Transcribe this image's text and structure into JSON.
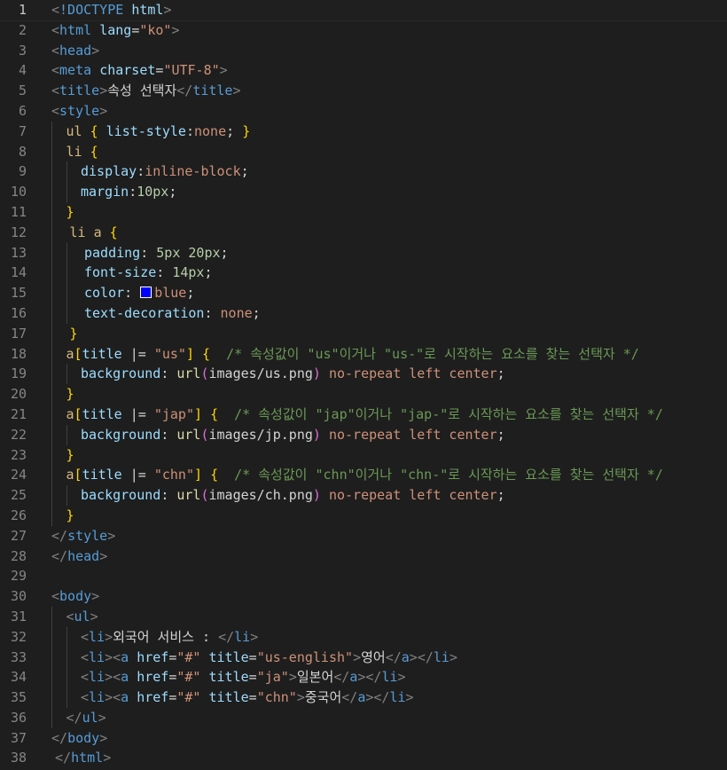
{
  "editor": {
    "colors": {
      "background": "#1e1e1e",
      "tag": "#569cd6",
      "attribute": "#9cdcfe",
      "string": "#ce9178",
      "comment": "#6a9955",
      "selector": "#d7ba7d",
      "brace": "#ffd700",
      "swatch_blue": "#0000ff"
    },
    "current_line": 1,
    "lines": [
      {
        "n": "1",
        "indent": 0,
        "tokens": [
          [
            "punc",
            "<"
          ],
          [
            "tag",
            "!DOCTYPE"
          ],
          [
            "text",
            " "
          ],
          [
            "attr",
            "html"
          ],
          [
            "punc",
            ">"
          ]
        ]
      },
      {
        "n": "2",
        "indent": 0,
        "tokens": [
          [
            "punc",
            "<"
          ],
          [
            "tag",
            "html"
          ],
          [
            "text",
            " "
          ],
          [
            "attr",
            "lang"
          ],
          [
            "text",
            "="
          ],
          [
            "str",
            "\"ko\""
          ],
          [
            "punc",
            ">"
          ]
        ]
      },
      {
        "n": "3",
        "indent": 0,
        "tokens": [
          [
            "punc",
            "<"
          ],
          [
            "tag",
            "head"
          ],
          [
            "punc",
            ">"
          ]
        ]
      },
      {
        "n": "4",
        "indent": 0,
        "tokens": [
          [
            "punc",
            "<"
          ],
          [
            "tag",
            "meta"
          ],
          [
            "text",
            " "
          ],
          [
            "attr",
            "charset"
          ],
          [
            "text",
            "="
          ],
          [
            "str",
            "\"UTF-8\""
          ],
          [
            "punc",
            ">"
          ]
        ]
      },
      {
        "n": "5",
        "indent": 0,
        "tokens": [
          [
            "punc",
            "<"
          ],
          [
            "tag",
            "title"
          ],
          [
            "punc",
            ">"
          ],
          [
            "text",
            "속성 선택자"
          ],
          [
            "punc",
            "</"
          ],
          [
            "tag",
            "title"
          ],
          [
            "punc",
            ">"
          ]
        ]
      },
      {
        "n": "6",
        "indent": 0,
        "tokens": [
          [
            "punc",
            "<"
          ],
          [
            "tag",
            "style"
          ],
          [
            "punc",
            ">"
          ]
        ]
      },
      {
        "n": "7",
        "indent": 1,
        "tokens": [
          [
            "sel",
            "ul"
          ],
          [
            "text",
            " "
          ],
          [
            "brace",
            "{"
          ],
          [
            "text",
            " "
          ],
          [
            "prop",
            "list-style"
          ],
          [
            "text",
            ":"
          ],
          [
            "val",
            "none"
          ],
          [
            "text",
            "; "
          ],
          [
            "brace",
            "}"
          ]
        ]
      },
      {
        "n": "8",
        "indent": 1,
        "tokens": [
          [
            "sel",
            "li"
          ],
          [
            "text",
            " "
          ],
          [
            "brace",
            "{"
          ]
        ]
      },
      {
        "n": "9",
        "indent": 2,
        "tokens": [
          [
            "prop",
            "display"
          ],
          [
            "text",
            ":"
          ],
          [
            "val",
            "inline-block"
          ],
          [
            "text",
            ";"
          ]
        ]
      },
      {
        "n": "10",
        "indent": 2,
        "tokens": [
          [
            "prop",
            "margin"
          ],
          [
            "text",
            ":"
          ],
          [
            "num",
            "10px"
          ],
          [
            "text",
            ";"
          ]
        ]
      },
      {
        "n": "11",
        "indent": 1,
        "tokens": [
          [
            "brace",
            "}"
          ]
        ]
      },
      {
        "n": "12",
        "indent": 1,
        "extra": " ",
        "tokens": [
          [
            "sel",
            "li a"
          ],
          [
            "text",
            " "
          ],
          [
            "brace",
            "{"
          ]
        ]
      },
      {
        "n": "13",
        "indent": 2,
        "extra": " ",
        "tokens": [
          [
            "prop",
            "padding"
          ],
          [
            "text",
            ": "
          ],
          [
            "num",
            "5px 20px"
          ],
          [
            "text",
            ";"
          ]
        ]
      },
      {
        "n": "14",
        "indent": 2,
        "extra": " ",
        "tokens": [
          [
            "prop",
            "font-size"
          ],
          [
            "text",
            ": "
          ],
          [
            "num",
            "14px"
          ],
          [
            "text",
            ";"
          ]
        ]
      },
      {
        "n": "15",
        "indent": 2,
        "extra": " ",
        "tokens": [
          [
            "prop",
            "color"
          ],
          [
            "text",
            ": "
          ],
          [
            "swatch",
            "#0000ff"
          ],
          [
            "val",
            "blue"
          ],
          [
            "text",
            ";"
          ]
        ]
      },
      {
        "n": "16",
        "indent": 2,
        "extra": " ",
        "tokens": [
          [
            "prop",
            "text-decoration"
          ],
          [
            "text",
            ": "
          ],
          [
            "val",
            "none"
          ],
          [
            "text",
            ";"
          ]
        ]
      },
      {
        "n": "17",
        "indent": 1,
        "extra": " ",
        "tokens": [
          [
            "brace",
            "}"
          ]
        ]
      },
      {
        "n": "18",
        "indent": 1,
        "tokens": [
          [
            "sel",
            "a"
          ],
          [
            "brace",
            "["
          ],
          [
            "attr",
            "title"
          ],
          [
            "text",
            " |= "
          ],
          [
            "str",
            "\"us\""
          ],
          [
            "brace",
            "]"
          ],
          [
            "text",
            " "
          ],
          [
            "brace",
            "{"
          ],
          [
            "text",
            "  "
          ],
          [
            "comment",
            "/* 속성값이 \"us\"이거나 \"us-\"로 시작하는 요소를 찾는 선택자 */"
          ]
        ]
      },
      {
        "n": "19",
        "indent": 2,
        "tokens": [
          [
            "prop",
            "background"
          ],
          [
            "text",
            ": "
          ],
          [
            "func",
            "url"
          ],
          [
            "paren",
            "("
          ],
          [
            "text",
            "images/us.png"
          ],
          [
            "paren",
            ")"
          ],
          [
            "text",
            " "
          ],
          [
            "val",
            "no-repeat left center"
          ],
          [
            "text",
            ";"
          ]
        ]
      },
      {
        "n": "20",
        "indent": 1,
        "tokens": [
          [
            "brace",
            "}"
          ]
        ]
      },
      {
        "n": "21",
        "indent": 1,
        "tokens": [
          [
            "sel",
            "a"
          ],
          [
            "brace",
            "["
          ],
          [
            "attr",
            "title"
          ],
          [
            "text",
            " |= "
          ],
          [
            "str",
            "\"jap\""
          ],
          [
            "brace",
            "]"
          ],
          [
            "text",
            " "
          ],
          [
            "brace",
            "{"
          ],
          [
            "text",
            "  "
          ],
          [
            "comment",
            "/* 속성값이 \"jap\"이거나 \"jap-\"로 시작하는 요소를 찾는 선택자 */"
          ]
        ]
      },
      {
        "n": "22",
        "indent": 2,
        "tokens": [
          [
            "prop",
            "background"
          ],
          [
            "text",
            ": "
          ],
          [
            "func",
            "url"
          ],
          [
            "paren",
            "("
          ],
          [
            "text",
            "images/jp.png"
          ],
          [
            "paren",
            ")"
          ],
          [
            "text",
            " "
          ],
          [
            "val",
            "no-repeat left center"
          ],
          [
            "text",
            ";"
          ]
        ]
      },
      {
        "n": "23",
        "indent": 1,
        "tokens": [
          [
            "brace",
            "}"
          ]
        ]
      },
      {
        "n": "24",
        "indent": 1,
        "tokens": [
          [
            "sel",
            "a"
          ],
          [
            "brace",
            "["
          ],
          [
            "attr",
            "title"
          ],
          [
            "text",
            " |= "
          ],
          [
            "str",
            "\"chn\""
          ],
          [
            "brace",
            "]"
          ],
          [
            "text",
            " "
          ],
          [
            "brace",
            "{"
          ],
          [
            "text",
            "  "
          ],
          [
            "comment",
            "/* 속성값이 \"chn\"이거나 \"chn-\"로 시작하는 요소를 찾는 선택자 */"
          ]
        ]
      },
      {
        "n": "25",
        "indent": 2,
        "tokens": [
          [
            "prop",
            "background"
          ],
          [
            "text",
            ": "
          ],
          [
            "func",
            "url"
          ],
          [
            "paren",
            "("
          ],
          [
            "text",
            "images/ch.png"
          ],
          [
            "paren",
            ")"
          ],
          [
            "text",
            " "
          ],
          [
            "val",
            "no-repeat left center"
          ],
          [
            "text",
            ";"
          ]
        ]
      },
      {
        "n": "26",
        "indent": 1,
        "tokens": [
          [
            "brace",
            "}"
          ]
        ]
      },
      {
        "n": "27",
        "indent": 0,
        "tokens": [
          [
            "punc",
            "</"
          ],
          [
            "tag",
            "style"
          ],
          [
            "punc",
            ">"
          ]
        ]
      },
      {
        "n": "28",
        "indent": 0,
        "tokens": [
          [
            "punc",
            "</"
          ],
          [
            "tag",
            "head"
          ],
          [
            "punc",
            ">"
          ]
        ]
      },
      {
        "n": "29",
        "indent": 0,
        "tokens": []
      },
      {
        "n": "30",
        "indent": 0,
        "tokens": [
          [
            "punc",
            "<"
          ],
          [
            "tag",
            "body"
          ],
          [
            "punc",
            ">"
          ]
        ]
      },
      {
        "n": "31",
        "indent": 1,
        "tokens": [
          [
            "punc",
            "<"
          ],
          [
            "tag",
            "ul"
          ],
          [
            "punc",
            ">"
          ]
        ]
      },
      {
        "n": "32",
        "indent": 2,
        "tokens": [
          [
            "punc",
            "<"
          ],
          [
            "tag",
            "li"
          ],
          [
            "punc",
            ">"
          ],
          [
            "text",
            "외국어 서비스 : "
          ],
          [
            "punc",
            "</"
          ],
          [
            "tag",
            "li"
          ],
          [
            "punc",
            ">"
          ]
        ]
      },
      {
        "n": "33",
        "indent": 2,
        "tokens": [
          [
            "punc",
            "<"
          ],
          [
            "tag",
            "li"
          ],
          [
            "punc",
            "><"
          ],
          [
            "tag",
            "a"
          ],
          [
            "text",
            " "
          ],
          [
            "attr",
            "href"
          ],
          [
            "text",
            "="
          ],
          [
            "str",
            "\"#\""
          ],
          [
            "text",
            " "
          ],
          [
            "attr",
            "title"
          ],
          [
            "text",
            "="
          ],
          [
            "str",
            "\"us-english\""
          ],
          [
            "punc",
            ">"
          ],
          [
            "text",
            "영어"
          ],
          [
            "punc",
            "</"
          ],
          [
            "tag",
            "a"
          ],
          [
            "punc",
            "></"
          ],
          [
            "tag",
            "li"
          ],
          [
            "punc",
            ">"
          ]
        ]
      },
      {
        "n": "34",
        "indent": 2,
        "tokens": [
          [
            "punc",
            "<"
          ],
          [
            "tag",
            "li"
          ],
          [
            "punc",
            "><"
          ],
          [
            "tag",
            "a"
          ],
          [
            "text",
            " "
          ],
          [
            "attr",
            "href"
          ],
          [
            "text",
            "="
          ],
          [
            "str",
            "\"#\""
          ],
          [
            "text",
            " "
          ],
          [
            "attr",
            "title"
          ],
          [
            "text",
            "="
          ],
          [
            "str",
            "\"ja\""
          ],
          [
            "punc",
            ">"
          ],
          [
            "text",
            "일본어"
          ],
          [
            "punc",
            "</"
          ],
          [
            "tag",
            "a"
          ],
          [
            "punc",
            "></"
          ],
          [
            "tag",
            "li"
          ],
          [
            "punc",
            ">"
          ]
        ]
      },
      {
        "n": "35",
        "indent": 2,
        "tokens": [
          [
            "punc",
            "<"
          ],
          [
            "tag",
            "li"
          ],
          [
            "punc",
            "><"
          ],
          [
            "tag",
            "a"
          ],
          [
            "text",
            " "
          ],
          [
            "attr",
            "href"
          ],
          [
            "text",
            "="
          ],
          [
            "str",
            "\"#\""
          ],
          [
            "text",
            " "
          ],
          [
            "attr",
            "title"
          ],
          [
            "text",
            "="
          ],
          [
            "str",
            "\"chn\""
          ],
          [
            "punc",
            ">"
          ],
          [
            "text",
            "중국어"
          ],
          [
            "punc",
            "</"
          ],
          [
            "tag",
            "a"
          ],
          [
            "punc",
            "></"
          ],
          [
            "tag",
            "li"
          ],
          [
            "punc",
            ">"
          ]
        ]
      },
      {
        "n": "36",
        "indent": 1,
        "tokens": [
          [
            "punc",
            "</"
          ],
          [
            "tag",
            "ul"
          ],
          [
            "punc",
            ">"
          ]
        ]
      },
      {
        "n": "37",
        "indent": 0,
        "tokens": [
          [
            "punc",
            "</"
          ],
          [
            "tag",
            "body"
          ],
          [
            "punc",
            ">"
          ]
        ]
      },
      {
        "n": "38",
        "indent": 0,
        "extra": " ",
        "tokens": [
          [
            "punc",
            "</"
          ],
          [
            "tag",
            "html"
          ],
          [
            "punc",
            ">"
          ]
        ]
      }
    ]
  }
}
